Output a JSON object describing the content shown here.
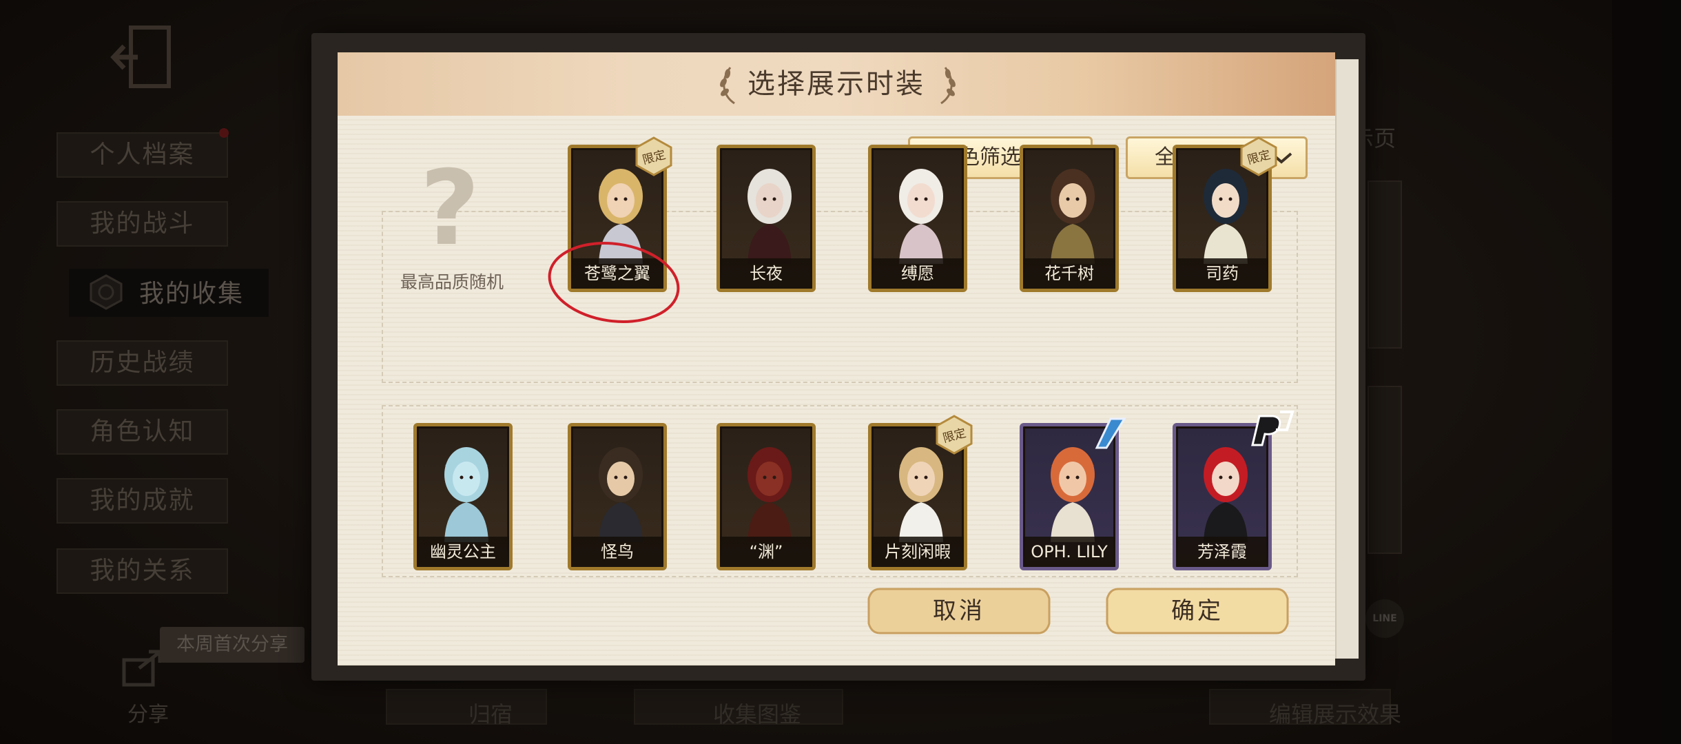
{
  "background": {
    "menu_items": [
      "个人档案",
      "我的战斗",
      "我的收集",
      "历史战绩",
      "角色认知",
      "我的成就",
      "我的关系"
    ],
    "active_item": "我的收集",
    "share_tip": "本周首次分享",
    "share_label": "分享",
    "bottom_labels": [
      "归宿",
      "收集图鉴",
      "编辑展示效果"
    ],
    "right_label": "示页"
  },
  "dialog": {
    "title": "选择展示时装",
    "filters": {
      "role_filter": "角色筛选",
      "quality_filter": "全部品质"
    },
    "random_label": "最高品质随机",
    "row1": [
      {
        "name": "苍鹭之翼",
        "limited": true,
        "badge": "限定",
        "frame": "gold",
        "hair": "#d9b56a",
        "skin": "#f0d2b4",
        "outfit": "#c8c8d2"
      },
      {
        "name": "长夜",
        "limited": false,
        "badge": "",
        "frame": "gold",
        "hair": "#e6e2dc",
        "skin": "#e8d4c8",
        "outfit": "#3a1a1a"
      },
      {
        "name": "缚愿",
        "limited": false,
        "badge": "",
        "frame": "gold",
        "hair": "#f0ece6",
        "skin": "#f2dcd0",
        "outfit": "#d8c4c8"
      },
      {
        "name": "花千树",
        "limited": false,
        "badge": "",
        "frame": "gold",
        "hair": "#4a3020",
        "skin": "#e8caa8",
        "outfit": "#8a7440"
      },
      {
        "name": "司药",
        "limited": true,
        "badge": "限定",
        "frame": "gold",
        "hair": "#1e2a38",
        "skin": "#f2dcc8",
        "outfit": "#e8e4d0"
      }
    ],
    "row2": [
      {
        "name": "幽灵公主",
        "limited": false,
        "badge": "",
        "frame": "gold",
        "hair": "#a8d4e0",
        "skin": "#c8e8f0",
        "outfit": "#9cc8d8"
      },
      {
        "name": "怪鸟",
        "limited": false,
        "badge": "",
        "frame": "gold",
        "hair": "#3a2c20",
        "skin": "#e6caa8",
        "outfit": "#2a2a30"
      },
      {
        "name": "“渊”",
        "limited": false,
        "badge": "",
        "frame": "gold",
        "hair": "#6a1a18",
        "skin": "#8a3024",
        "outfit": "#4a1c14"
      },
      {
        "name": "片刻闲暇",
        "limited": true,
        "badge": "限定",
        "frame": "gold",
        "hair": "#d8b880",
        "skin": "#f0d4b8",
        "outfit": "#f2f0ea"
      },
      {
        "name": "OPH. LILY",
        "limited": false,
        "badge": "",
        "frame": "purple",
        "hair": "#d86a3a",
        "skin": "#f0c8a8",
        "outfit": "#e8e0d0"
      },
      {
        "name": "芳泽霞",
        "limited": false,
        "badge": "",
        "frame": "purple",
        "hair": "#c41c24",
        "skin": "#f2d8c8",
        "outfit": "#1a1a1c"
      }
    ],
    "buttons": {
      "cancel": "取消",
      "confirm": "确定"
    }
  }
}
